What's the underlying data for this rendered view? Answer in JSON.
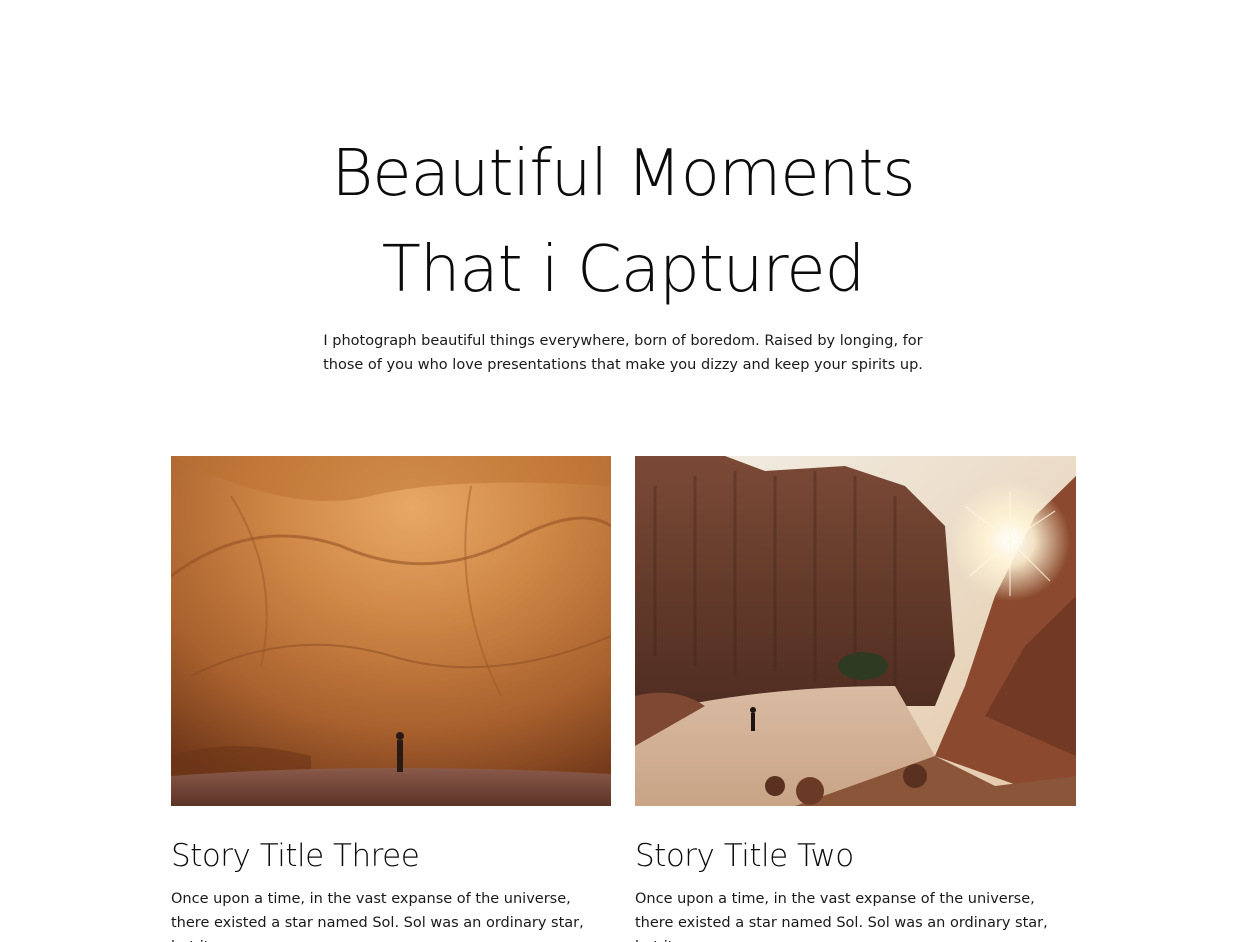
{
  "hero": {
    "title": "Beautiful Moments That i Captured",
    "subtitle": "I photograph beautiful things everywhere, born of boredom. Raised by longing, for those of you who love presentations that make you dizzy and keep your spirits up."
  },
  "stories": [
    {
      "title": "Story Title Three",
      "excerpt": "Once upon a time, in the vast expanse of the universe, there existed a star named Sol. Sol was an ordinary star, but it...",
      "image": "photo-desert-cave-overhang"
    },
    {
      "title": "Story Title Two",
      "excerpt": "Once upon a time, in the vast expanse of the universe, there existed a star named Sol. Sol was an ordinary star, but it...",
      "image": "photo-canyon-sunburst"
    }
  ],
  "colors": {
    "background": "#ffffff",
    "text": "#0b0b0b",
    "sandstone": "#c47a3c",
    "canyon_rock": "#6e3b26",
    "sand": "#d9b8a0"
  }
}
